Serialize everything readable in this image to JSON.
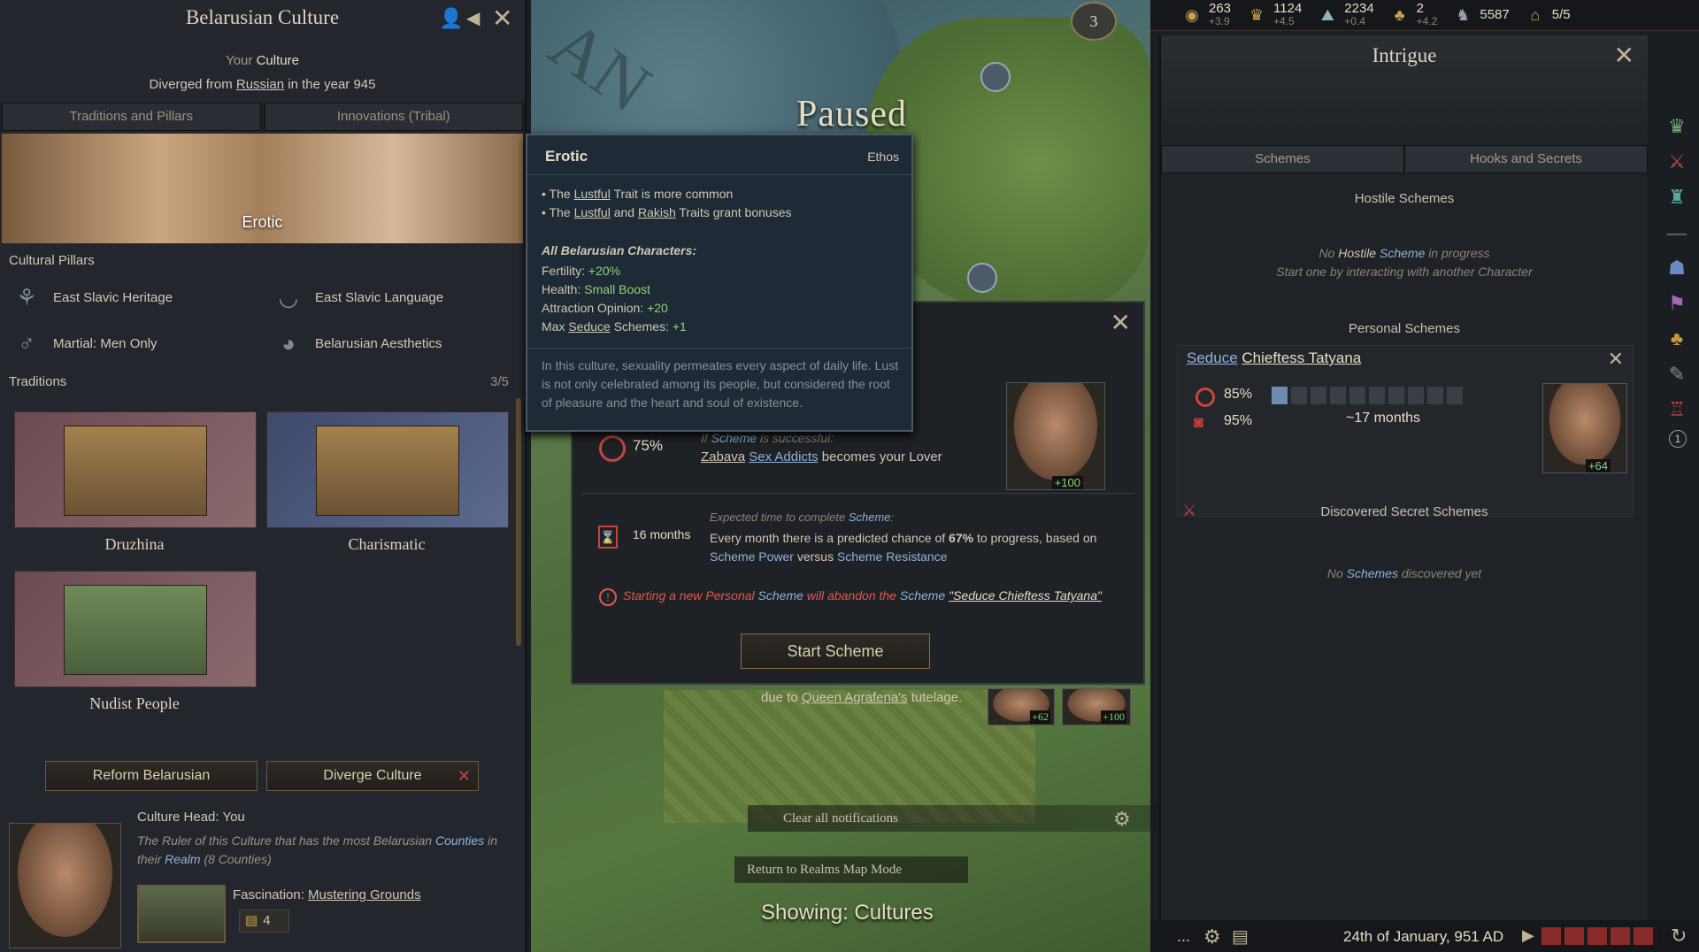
{
  "map": {
    "paused_label": "Paused",
    "showing_label": "Showing: Cultures",
    "province_count": "3",
    "clear_notifications": "Clear all notifications",
    "return_map_mode": "Return to Realms Map Mode",
    "tutelage_text_pre": "due to",
    "tutelage_link": "Queen Agrafena's",
    "tutelage_text_post": "tutelage.",
    "tutelage_portrait_1": "+62",
    "tutelage_portrait_2": "+100"
  },
  "culture": {
    "title": "Belarusian Culture",
    "your_culture_pre": "Your",
    "your_culture": "Culture",
    "diverged_pre": "Diverged from",
    "diverged_link": "Russian",
    "diverged_post": "in the year 945",
    "tabs": [
      "Traditions and Pillars",
      "Innovations (Tribal)"
    ],
    "ethos_name": "Erotic",
    "pillars_title": "Cultural Pillars",
    "pillars": [
      {
        "label": "East Slavic Heritage",
        "icon": "heritage-icon"
      },
      {
        "label": "East Slavic Language",
        "icon": "language-icon"
      },
      {
        "label": "Martial: Men Only",
        "icon": "martial-icon"
      },
      {
        "label": "Belarusian Aesthetics",
        "icon": "aesthetics-icon"
      }
    ],
    "traditions_title": "Traditions",
    "traditions_count": "3/5",
    "traditions": [
      {
        "label": "Druzhina"
      },
      {
        "label": "Charismatic"
      },
      {
        "label": "Nudist People"
      }
    ],
    "reform_button": "Reform Belarusian",
    "diverge_button": "Diverge Culture",
    "head_title": "Culture Head: You",
    "head_desc_1": "The Ruler of this Culture that has the most Belarusian",
    "head_desc_link": "Counties",
    "head_desc_2": "in their",
    "head_desc_realm": "Realm",
    "head_desc_3": "(8 Counties)",
    "fascination_label": "Fascination:",
    "fascination_link": "Mustering Grounds",
    "fascination_count": "4"
  },
  "tooltip": {
    "title": "Erotic",
    "type": "Ethos",
    "bullet1_pre": "• The",
    "bullet1_link": "Lustful",
    "bullet1_post": "Trait is more common",
    "bullet2_pre": "• The",
    "bullet2_link1": "Lustful",
    "bullet2_mid": "and",
    "bullet2_link2": "Rakish",
    "bullet2_post": "Traits grant bonuses",
    "all_chars": "All Belarusian Characters:",
    "fertility_label": "Fertility:",
    "fertility_val": "+20%",
    "health_label": "Health:",
    "health_val": "Small Boost",
    "attraction_label": "Attraction Opinion:",
    "attraction_val": "+20",
    "max_label_pre": "Max",
    "max_link": "Seduce",
    "max_label_post": "Schemes:",
    "max_val": "+1",
    "flavor": "In this culture, sexuality permeates every aspect of daily life. Lust is not only celebrated among its people, but considered the root of pleasure and the heart and soul of existence."
  },
  "scheme": {
    "chance": "75%",
    "if_pre": "If",
    "if_link": "Scheme",
    "if_post": "is successful:",
    "result_link1": "Zabava",
    "result_link2": "Sex Addicts",
    "result_post": "becomes your Lover",
    "target_opinion": "+100",
    "duration": "16 months",
    "expected_pre": "Expected time to complete",
    "expected_link": "Scheme",
    "expected_post": ":",
    "monthly_pre": "Every month there is a predicted chance of",
    "monthly_pct": "67%",
    "monthly_mid": "to progress, based on",
    "monthly_link1": "Scheme Power",
    "monthly_and": "versus",
    "monthly_link2": "Scheme Resistance",
    "warning_pre": "Starting a new Personal",
    "warning_link": "Scheme",
    "warning_mid": "will abandon the",
    "warning_link2": "Scheme",
    "warning_quote": "\"Seduce Chieftess Tatyana\"",
    "start_button": "Start Scheme"
  },
  "intrigue": {
    "title": "Intrigue",
    "tabs": [
      "Schemes",
      "Hooks and Secrets"
    ],
    "hostile_title": "Hostile Schemes",
    "hostile_none_pre": "No",
    "hostile_none_word": "Hostile",
    "hostile_none_link": "Scheme",
    "hostile_none_post": "in progress",
    "hostile_hint": "Start one by interacting with another Character",
    "personal_title": "Personal Schemes",
    "personal_scheme_link": "Seduce",
    "personal_scheme_target": "Chieftess Tatyana",
    "success": "85%",
    "secrecy": "95%",
    "progress_filled": 1,
    "progress_total": 10,
    "time_left": "~17 months",
    "target_opinion": "+64",
    "discovered_title": "Discovered Secret Schemes",
    "discovered_none_pre": "No",
    "discovered_none_link": "Schemes",
    "discovered_none_post": "discovered yet"
  },
  "topbar": {
    "resources": [
      {
        "icon": "gold-icon",
        "value": "263",
        "delta": "+3.9"
      },
      {
        "icon": "prestige-icon",
        "value": "1124",
        "delta": "+4.5"
      },
      {
        "icon": "piety-icon",
        "value": "2234",
        "delta": "+0.4"
      },
      {
        "icon": "dynasty-icon",
        "value": "2",
        "delta": "+4.2"
      },
      {
        "icon": "soldiers-icon",
        "value": "5587",
        "delta": ""
      },
      {
        "icon": "domain-icon",
        "value": "5/5",
        "delta": ""
      }
    ]
  },
  "bottombar": {
    "date": "24th of January, 951 AD",
    "more": "..."
  },
  "rightrail": {
    "count_badge": "1"
  },
  "colors": {
    "accent_gold": "#c8a44f",
    "positive": "#8ed37a",
    "warning": "#e05a4e",
    "link_blue": "#8fb3d9"
  }
}
